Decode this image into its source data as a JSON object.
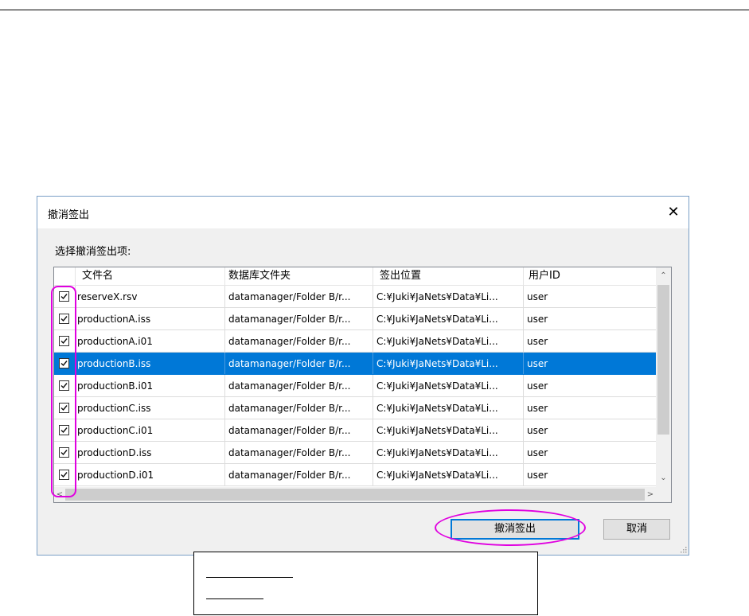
{
  "dialog": {
    "title": "撤消签出",
    "close_glyph": "✕",
    "prompt": "选择撤消签出项:"
  },
  "list": {
    "columns": [
      "文件名",
      "数据库文件夹",
      "签出位置",
      "用户ID"
    ],
    "rows": [
      {
        "checked": true,
        "selected": false,
        "name": "reserveX.rsv",
        "folder": "datamanager/Folder B/r...",
        "location": "C:¥Juki¥JaNets¥Data¥Li...",
        "user": "user"
      },
      {
        "checked": true,
        "selected": false,
        "name": "productionA.iss",
        "folder": "datamanager/Folder B/r...",
        "location": "C:¥Juki¥JaNets¥Data¥Li...",
        "user": "user"
      },
      {
        "checked": true,
        "selected": false,
        "name": "productionA.i01",
        "folder": "datamanager/Folder B/r...",
        "location": "C:¥Juki¥JaNets¥Data¥Li...",
        "user": "user"
      },
      {
        "checked": true,
        "selected": true,
        "name": "productionB.iss",
        "folder": "datamanager/Folder B/r...",
        "location": "C:¥Juki¥JaNets¥Data¥Li...",
        "user": "user"
      },
      {
        "checked": true,
        "selected": false,
        "name": "productionB.i01",
        "folder": "datamanager/Folder B/r...",
        "location": "C:¥Juki¥JaNets¥Data¥Li...",
        "user": "user"
      },
      {
        "checked": true,
        "selected": false,
        "name": "productionC.iss",
        "folder": "datamanager/Folder B/r...",
        "location": "C:¥Juki¥JaNets¥Data¥Li...",
        "user": "user"
      },
      {
        "checked": true,
        "selected": false,
        "name": "productionC.i01",
        "folder": "datamanager/Folder B/r...",
        "location": "C:¥Juki¥JaNets¥Data¥Li...",
        "user": "user"
      },
      {
        "checked": true,
        "selected": false,
        "name": "productionD.iss",
        "folder": "datamanager/Folder B/r...",
        "location": "C:¥Juki¥JaNets¥Data¥Li...",
        "user": "user"
      },
      {
        "checked": true,
        "selected": false,
        "name": "productionD.i01",
        "folder": "datamanager/Folder B/r...",
        "location": "C:¥Juki¥JaNets¥Data¥Li...",
        "user": "user"
      }
    ]
  },
  "buttons": {
    "undo_checkout": "撤消签出",
    "cancel": "取消"
  },
  "colors": {
    "selection": "#0078d7",
    "annotation": "#e000e0"
  }
}
